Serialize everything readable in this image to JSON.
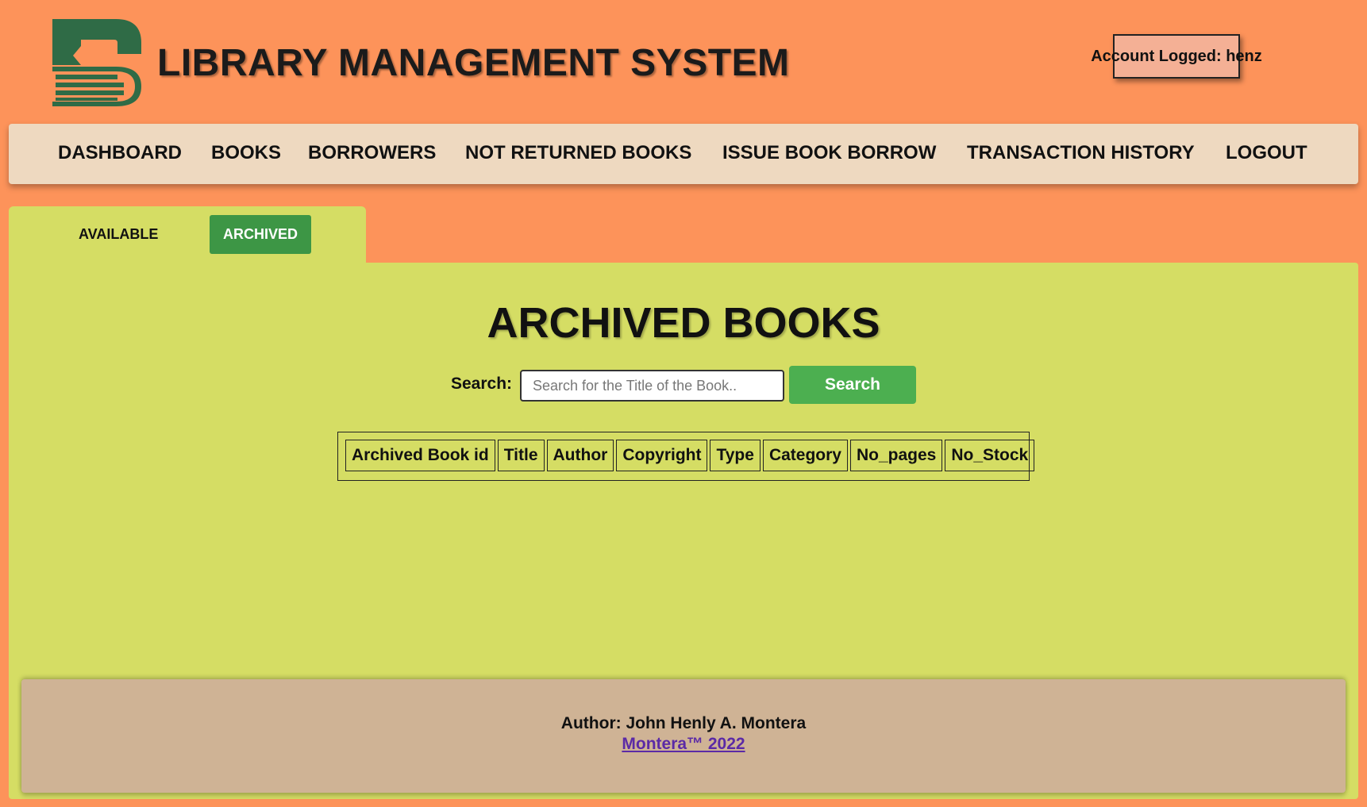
{
  "header": {
    "site_title": "LIBRARY MANAGEMENT SYSTEM",
    "account_label": "Account Logged: henz",
    "logo_icon": "book-stack-logo-icon",
    "logo_color": "#2f6b46"
  },
  "nav": {
    "items": [
      {
        "label": "DASHBOARD"
      },
      {
        "label": "BOOKS"
      },
      {
        "label": "BORROWERS"
      },
      {
        "label": "NOT RETURNED BOOKS"
      },
      {
        "label": "ISSUE BOOK BORROW"
      },
      {
        "label": "TRANSACTION HISTORY"
      },
      {
        "label": "LOGOUT"
      }
    ]
  },
  "tabs": {
    "available": "AVAILABLE",
    "archived": "ARCHIVED",
    "active": "archived"
  },
  "main": {
    "title": "ARCHIVED BOOKS",
    "search_label": "Search:",
    "search_placeholder": "Search for the Title of the Book..",
    "search_value": "",
    "search_button": "Search",
    "table": {
      "columns": [
        "Archived Book id",
        "Title",
        "Author",
        "Copyright",
        "Type",
        "Category",
        "No_pages",
        "No_Stock"
      ],
      "rows": []
    }
  },
  "footer": {
    "author": "Author: John Henly A. Montera",
    "link_text": "Montera™ 2022"
  },
  "colors": {
    "page_background": "#fd935a",
    "nav_background": "#eed9c0",
    "panel_background": "#d5dd64",
    "accent_green": "#4caf50",
    "active_tab": "#3d9645",
    "footer_background": "#cfb395",
    "link_color": "#5b2aa6"
  }
}
